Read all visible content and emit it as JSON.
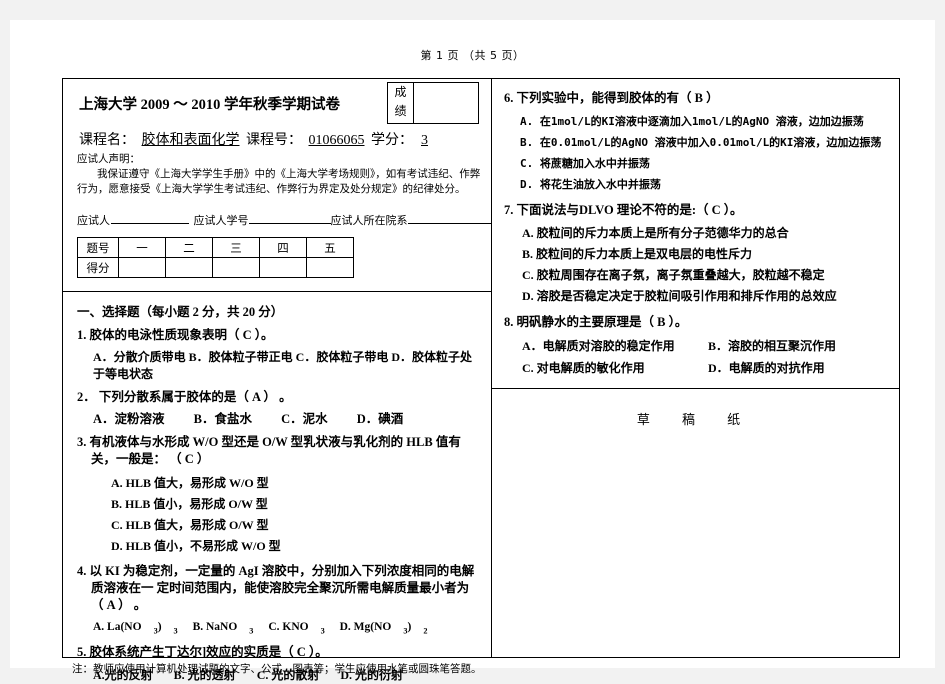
{
  "page": {
    "page_indicator": "第 1 页   （共 5 页）",
    "footnote": "注：教师应使用计算机处理试题的文字、公式、图表等；学生应使用水笔或圆珠笔答题。"
  },
  "header": {
    "title": "上海大学 2009 ～ 2010 学年秋季学期试卷",
    "score_label_1": "成",
    "score_label_2": "绩",
    "course_name_label": "课程名：",
    "course_name": "胶体和表面化学",
    "course_no_label": "课程号：",
    "course_no": "01066065",
    "credit_label": "学分：",
    "credit": "3",
    "declaration_title": "应试人声明：",
    "declaration_body": "我保证遵守《上海大学学生手册》中的《上海大学考场规则》，如有考试违纪、作弊行为，愿意接受《上海大学学生考试违纪、作弊行为界定及处分规定》的纪律处分。",
    "sign_name": "应试人",
    "sign_id": "应试人学号",
    "sign_dept": "应试人所在院系"
  },
  "score_table": {
    "row_label_1": "题号",
    "row_label_2": "得分",
    "columns": [
      "一",
      "二",
      "三",
      "四",
      "五"
    ]
  },
  "section": {
    "title": "一、选择题（每小题 2 分，共 20 分）"
  },
  "questions_left": [
    {
      "number": "1.",
      "stem": "胶体的电泳性质现象表明（ C ）。",
      "options_style": "inline",
      "options": "A．分散介质带电 B．胶体粒子带正电 C．胶体粒子带电 D．胶体粒子处于等电状态"
    },
    {
      "number": "2．",
      "stem": "下列分散系属于胶体的是（ A ） 。",
      "options_style": "spread",
      "options": [
        "A．淀粉溶液",
        "B．食盐水",
        "C．泥水",
        "D．碘酒"
      ]
    },
    {
      "number": "3.",
      "stem": "有机液体与水形成 W/O 型还是 O/W 型乳状液与乳化剂的 HLB 值有关，一般是：  （ C ）",
      "options_style": "stacked",
      "options": [
        "A. HLB 值大，易形成 W/O 型",
        "B. HLB 值小，易形成 O/W 型",
        "C. HLB 值大，易形成 O/W 型",
        "D. HLB 值小，不易形成 W/O 型"
      ]
    },
    {
      "number": "4.",
      "stem_line1": "以 KI 为稳定剂，一定量的 AgI 溶胶中，分别加入下列浓度相同的电解质溶液在一",
      "stem_line2": "定时间范围内，能使溶胶完全聚沉所需电解质量最小者为（ A ） 。",
      "options_style": "chem",
      "options": [
        {
          "label": "A. La(NO",
          "sub1": "3",
          "mid": ")",
          "sub2": "3"
        },
        {
          "label": "B. NaNO",
          "sub1": "3"
        },
        {
          "label": "C. KNO",
          "sub1": "3"
        },
        {
          "label": "D. Mg(NO",
          "sub1": "3",
          "mid": ")",
          "sub2": "2"
        }
      ]
    },
    {
      "number": "5.",
      "stem": "胶体系统产生丁达尔]效应的实质是（ C ）。",
      "options_style": "q5",
      "options": [
        "A.光的反射",
        "B. 光的透射",
        "C. 光的散射",
        "D. 光的衍射"
      ]
    }
  ],
  "questions_right": [
    {
      "number": "6.",
      "stem": "下列实验中，能得到胶体的有（  B ）",
      "options": [
        "A. 在1mol/L的KI溶液中逐滴加入1mol/L的AgNO 溶液，边加边振荡",
        "B. 在0.01mol/L的AgNO 溶液中加入0.01mol/L的KI溶液，边加边振荡",
        "C. 将蔗糖加入水中并振荡",
        "D. 将花生油放入水中并振荡"
      ]
    },
    {
      "number": "7.",
      "stem": "下面说法与DLVO 理论不符的是:（ C ）。",
      "options": [
        "A. 胶粒间的斥力本质上是所有分子范德华力的总合",
        "B. 胶粒间的斥力本质上是双电层的电性斥力",
        "C. 胶粒周围存在离子氛，离子氛重叠越大，胶粒越不稳定",
        "D. 溶胶是否稳定决定于胶粒间吸引作用和排斥作用的总效应"
      ]
    },
    {
      "number": "8.",
      "stem": "明矾静水的主要原理是（ B ）。",
      "options_2col": [
        [
          "A．电解质对溶胶的稳定作用",
          "B．溶胶的相互聚沉作用"
        ],
        [
          "C. 对电解质的敏化作用",
          "D．电解质的对抗作用"
        ]
      ]
    }
  ],
  "draft_area": {
    "label": "草 稿 纸"
  }
}
